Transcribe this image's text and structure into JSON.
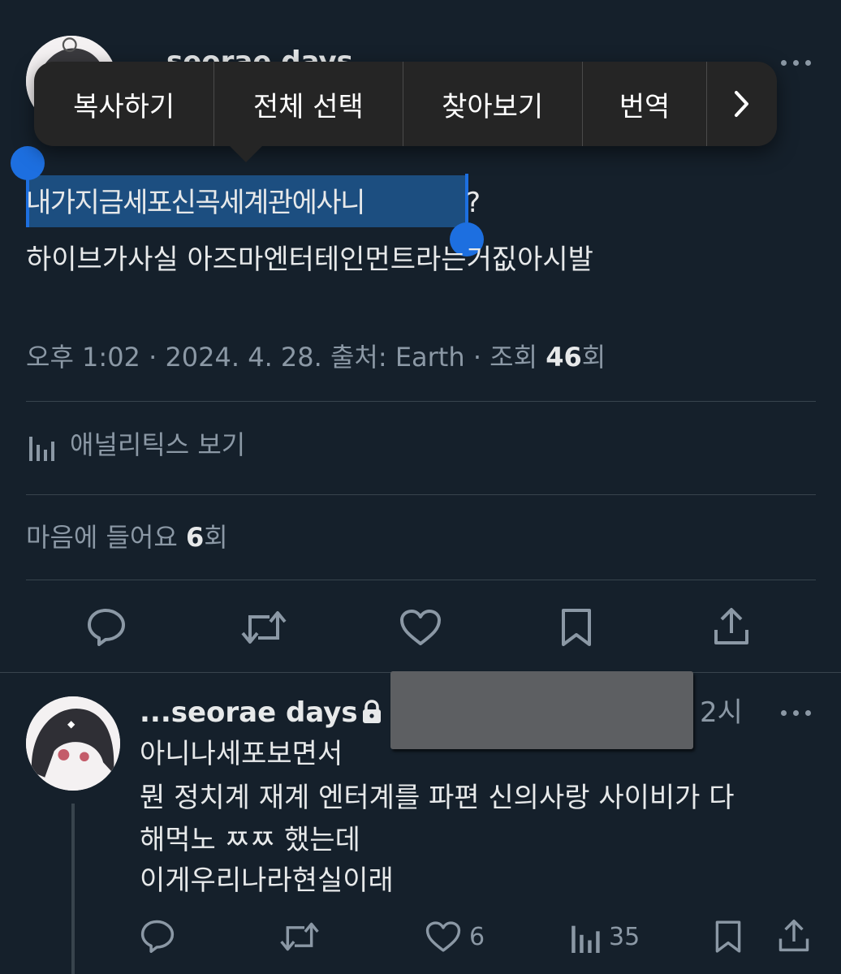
{
  "main_tweet": {
    "author_name": "seorae days",
    "text_line1_selected": "내가지금세포신곡세계관에사니",
    "text_line1_rest": "?",
    "text_line2": "하이브가사실 아즈마엔터테인먼트라는거짒아시발",
    "meta": {
      "time": "오후 1:02",
      "date": "2024. 4. 28.",
      "source": "출처: Earth",
      "views_label": "조회",
      "views_count": "46",
      "views_suffix": "회"
    },
    "analytics_label": "애널리틱스 보기",
    "likes_label": "마음에 들어요",
    "likes_count": "6",
    "likes_suffix": "회"
  },
  "context_menu": {
    "items": [
      "복사하기",
      "전체 선택",
      "찾아보기",
      "번역"
    ],
    "next_glyph": "›"
  },
  "reply": {
    "author_name": "...seorae days",
    "time": "2시",
    "lines": [
      "아니나세포보면서",
      "뭔 정치계 재계 엔터계를 파편 신의사랑 사이비가 다",
      "해먹노 ㅉㅉ 했는데",
      "이게우리나라현실이래"
    ],
    "like_count": "6",
    "view_count": "35"
  },
  "icons": [
    "lock-icon",
    "more-icon",
    "reply-icon",
    "retweet-icon",
    "like-icon",
    "bookmark-icon",
    "share-icon",
    "analytics-icon",
    "chevron-right-icon"
  ],
  "colors": {
    "background": "#15202b",
    "text": "#e7e9ea",
    "muted": "#8b98a5",
    "selection": "#1c4e80",
    "handle": "#1d6fe0",
    "menu": "#252525"
  }
}
